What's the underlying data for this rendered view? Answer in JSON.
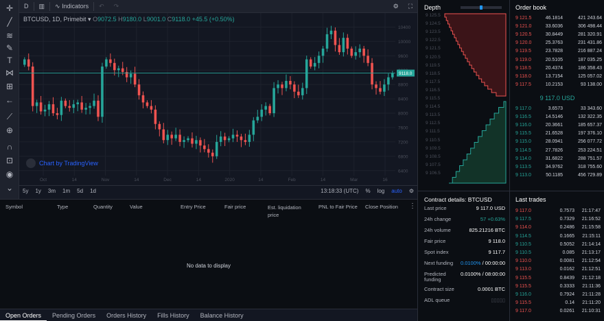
{
  "toolbar": {
    "interval": "D",
    "indicators_label": "Indicators"
  },
  "left_tools": [
    "crosshair-icon",
    "trendline-icon",
    "fib-icon",
    "brush-icon",
    "text-icon",
    "pattern-icon",
    "measure-icon",
    "arrow-left-icon",
    "ruler-icon",
    "zoom-icon",
    "magnet-icon",
    "lock-icon",
    "eye-icon"
  ],
  "legend": {
    "symbol": "BTCUSD, 1D, Primebit",
    "o_label": "O",
    "o_val": "9072.5",
    "h_label": "H",
    "h_val": "9180.0",
    "l_label": "L",
    "l_val": "9001.0",
    "c_label": "C",
    "c_val": "9118.0",
    "change": "+45.5 (+0.50%)"
  },
  "watermark": "Chart by TradingView",
  "chart_data": {
    "type": "candlestick",
    "y_ticks": [
      6400,
      6800,
      7200,
      7600,
      8000,
      8400,
      8800,
      9200,
      9600,
      10000,
      10400
    ],
    "ylim": [
      6300,
      10600
    ],
    "x_ticks": [
      "Oct",
      "14",
      "Nov",
      "14",
      "Dec",
      "14",
      "2020",
      "14",
      "Feb",
      "14",
      "Mar",
      "16"
    ],
    "last_price_label": "9118.0",
    "last_price": 9118.0,
    "close": [
      9500,
      9300,
      8200,
      8300,
      8050,
      8100,
      8250,
      8000,
      7950,
      8350,
      8200,
      8150,
      8250,
      8300,
      8100,
      8150,
      8200,
      8350,
      7900,
      9300,
      9500,
      9400,
      9200,
      9250,
      9150,
      9000,
      9100,
      8800,
      8500,
      8300,
      8200,
      8100,
      7700,
      7550,
      7250,
      7400,
      7300,
      7400,
      7200,
      7250,
      7300,
      7150,
      7250,
      7100,
      7000,
      6900,
      6800,
      7200,
      7350,
      7250,
      7300,
      7400,
      7350,
      7250,
      7200,
      7400,
      7800,
      7900,
      8100,
      8200,
      8000,
      8700,
      8800,
      8700,
      8900,
      8800,
      8600,
      8500,
      8700,
      9500,
      9300,
      9400,
      9600,
      9800,
      10200,
      10300,
      9900,
      9700,
      10100,
      9800,
      9600,
      9700,
      9800,
      9600,
      9400,
      8800,
      8700,
      8600,
      8800,
      9000,
      9118
    ],
    "high_low_span": 300
  },
  "range_bar": {
    "ranges": [
      "5y",
      "1y",
      "3m",
      "1m",
      "5d",
      "1d"
    ],
    "time": "13:18:33 (UTC)",
    "pct": "%",
    "log": "log",
    "auto": "auto"
  },
  "positions": {
    "headers": [
      "Symbol",
      "Type",
      "Quantity",
      "Value",
      "Entry Price",
      "Fair price",
      "Est. liquidation price",
      "PNL to Fair Price",
      "Close Position"
    ],
    "empty_text": "No data to display"
  },
  "bottom_tabs": [
    "Open Orders",
    "Pending Orders",
    "Orders History",
    "Fills History",
    "Balance History"
  ],
  "depth": {
    "title": "Depth",
    "labels": [
      "9 125.5",
      "9 124.5",
      "9 123.5",
      "9 122.5",
      "9 121.5",
      "9 120.5",
      "9 119.5",
      "9 118.5",
      "9 117.5",
      "9 116.5",
      "9 115.5",
      "9 114.5",
      "9 113.5",
      "9 112.5",
      "9 111.5",
      "9 110.5",
      "9 109.5",
      "9 108.5",
      "9 107.5",
      "9 106.5"
    ]
  },
  "orderbook": {
    "title": "Order book",
    "asks": [
      {
        "price": "9 121.5",
        "qty": "46.1814",
        "total": "421 243.64"
      },
      {
        "price": "9 121.0",
        "qty": "33.6036",
        "total": "306 498.44"
      },
      {
        "price": "9 120.5",
        "qty": "30.8449",
        "total": "281 320.91"
      },
      {
        "price": "9 120.0",
        "qty": "25.3763",
        "total": "231 431.86"
      },
      {
        "price": "9 119.5",
        "qty": "23.7828",
        "total": "216 887.24"
      },
      {
        "price": "9 119.0",
        "qty": "20.5105",
        "total": "187 035.25"
      },
      {
        "price": "9 118.5",
        "qty": "20.4374",
        "total": "186 358.43"
      },
      {
        "price": "9 118.0",
        "qty": "13.7154",
        "total": "125 057.02"
      },
      {
        "price": "9 117.5",
        "qty": "10.2153",
        "total": "93 138.00"
      }
    ],
    "mid": "9 117.0 USD",
    "bids": [
      {
        "price": "9 117.0",
        "qty": "3.6573",
        "total": "33 343.60"
      },
      {
        "price": "9 116.5",
        "qty": "14.5146",
        "total": "132 322.35"
      },
      {
        "price": "9 116.0",
        "qty": "20.3661",
        "total": "185 657.37"
      },
      {
        "price": "9 115.5",
        "qty": "21.6528",
        "total": "197 376.10"
      },
      {
        "price": "9 115.0",
        "qty": "28.0941",
        "total": "256 077.72"
      },
      {
        "price": "9 114.5",
        "qty": "27.7826",
        "total": "253 224.51"
      },
      {
        "price": "9 114.0",
        "qty": "31.6822",
        "total": "288 751.57"
      },
      {
        "price": "9 113.5",
        "qty": "34.9762",
        "total": "318 755.60"
      },
      {
        "price": "9 113.0",
        "qty": "50.1185",
        "total": "456 729.89"
      }
    ]
  },
  "contract": {
    "title": "Contract details: BTCUSD",
    "rows": [
      {
        "k": "Last price",
        "v": "9 117.0 USD"
      },
      {
        "k": "24h change",
        "v": "57 +0.63%"
      },
      {
        "k": "24h volume",
        "v": "825.21216 BTC"
      },
      {
        "k": "Fair price",
        "v": "9 118.0"
      },
      {
        "k": "Spot index",
        "v": "9 117.7"
      },
      {
        "k": "Next funding",
        "v_blue": "0.0100%",
        "v_rest": " / 00:00:00"
      },
      {
        "k": "Predicted funding",
        "v_blue": "0.0100%",
        "v_rest": " / 08:00:00",
        "v_white": true
      },
      {
        "k": "Contract size",
        "v": "0.0001 BTC"
      },
      {
        "k": "ADL queue",
        "v": "▯▯▯▯▯"
      }
    ]
  },
  "trades": {
    "title": "Last trades",
    "rows": [
      {
        "price": "9 117.0",
        "qty": "0.7573",
        "time": "21:17:47",
        "side": "sell"
      },
      {
        "price": "9 117.5",
        "qty": "0.7329",
        "time": "21:16:52",
        "side": "buy"
      },
      {
        "price": "9 114.0",
        "qty": "0.2486",
        "time": "21:15:58",
        "side": "sell"
      },
      {
        "price": "9 114.5",
        "qty": "0.1665",
        "time": "21:15:11",
        "side": "buy"
      },
      {
        "price": "9 110.5",
        "qty": "0.5052",
        "time": "21:14:14",
        "side": "buy"
      },
      {
        "price": "9 110.5",
        "qty": "0.085",
        "time": "21:13:17",
        "side": "buy"
      },
      {
        "price": "9 110.0",
        "qty": "0.0081",
        "time": "21:12:54",
        "side": "sell"
      },
      {
        "price": "9 113.0",
        "qty": "0.0162",
        "time": "21:12:51",
        "side": "sell"
      },
      {
        "price": "9 115.5",
        "qty": "0.8439",
        "time": "21:12:18",
        "side": "sell"
      },
      {
        "price": "9 115.5",
        "qty": "0.3333",
        "time": "21:11:36",
        "side": "sell"
      },
      {
        "price": "9 116.0",
        "qty": "0.7924",
        "time": "21:11:28",
        "side": "buy"
      },
      {
        "price": "9 115.5",
        "qty": "0.14",
        "time": "21:11:20",
        "side": "sell"
      },
      {
        "price": "9 117.0",
        "qty": "0.0261",
        "time": "21:10:31",
        "side": "sell"
      }
    ]
  },
  "colors": {
    "up": "#26a69a",
    "down": "#ef5350",
    "accent": "#2962ff"
  }
}
